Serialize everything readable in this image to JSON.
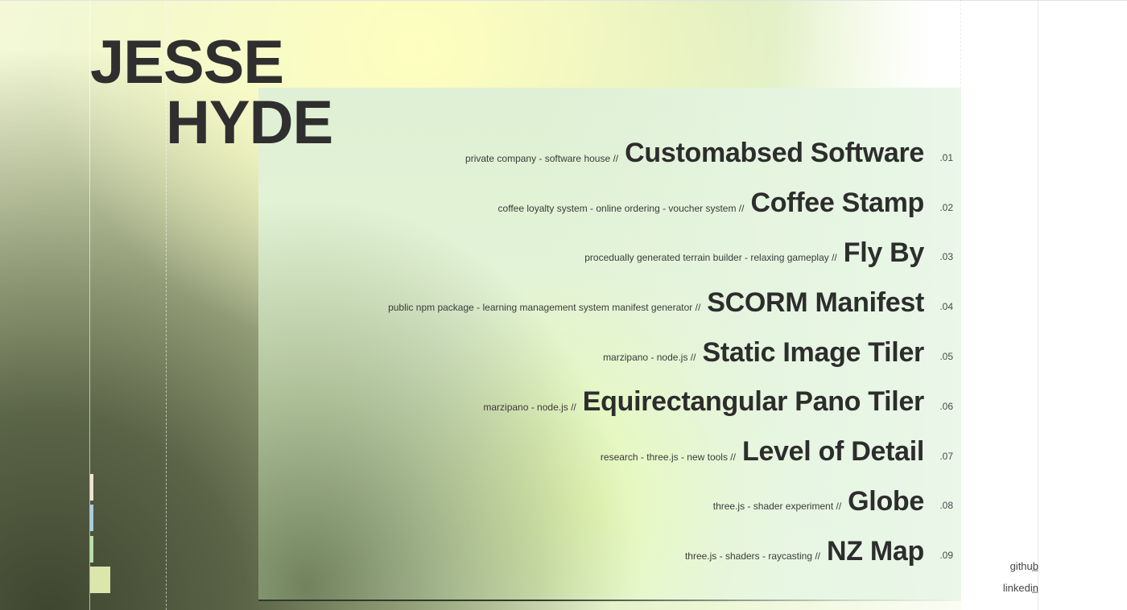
{
  "header": {
    "first_name": "JESSE",
    "last_name": "HYDE"
  },
  "projects": [
    {
      "description": "private company - software house //",
      "title": "Customabsed Software",
      "number": ".01"
    },
    {
      "description": "coffee loyalty system - online ordering - voucher system //",
      "title": "Coffee Stamp",
      "number": ".02"
    },
    {
      "description": "procedually generated terrain builder - relaxing gameplay //",
      "title": "Fly By",
      "number": ".03"
    },
    {
      "description": "public npm package - learning management system manifest generator //",
      "title": "SCORM Manifest",
      "number": ".04"
    },
    {
      "description": "marzipano - node.js //",
      "title": "Static Image Tiler",
      "number": ".05"
    },
    {
      "description": "marzipano - node.js //",
      "title": "Equirectangular Pano Tiler",
      "number": ".06"
    },
    {
      "description": "research - three.js - new tools //",
      "title": "Level of Detail",
      "number": ".07"
    },
    {
      "description": "three.js - shader experiment //",
      "title": "Globe",
      "number": ".08"
    },
    {
      "description": "three.js - shaders - raycasting //",
      "title": "NZ Map",
      "number": ".09"
    }
  ],
  "social": {
    "github": "github",
    "linkedin": "linkedin",
    "dash": "_"
  },
  "colors": {
    "text": "#2d2d2d",
    "swatch_1": "#efe5d2",
    "swatch_2": "#a9cde0",
    "swatch_3": "#b6e0a8",
    "swatch_4": "#dbe6aa"
  }
}
